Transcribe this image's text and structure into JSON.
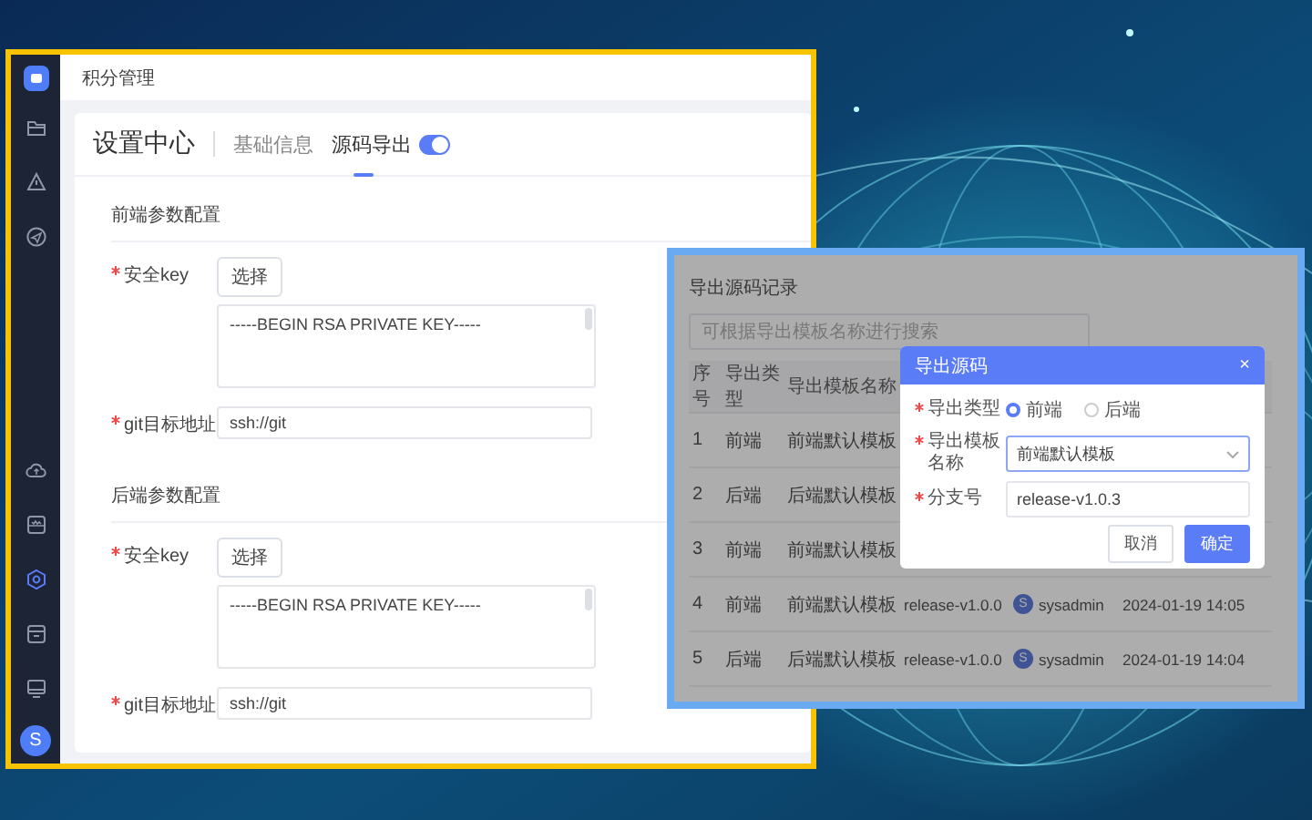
{
  "app_window": {
    "breadcrumb": "积分管理",
    "sidebar": {
      "top_items": [
        {
          "selected": false
        },
        {
          "selected": false
        },
        {
          "selected": false
        }
      ],
      "bottom_items": [
        {
          "selected": false
        },
        {
          "selected": false
        },
        {
          "selected": true
        },
        {
          "selected": false
        },
        {
          "selected": false
        }
      ],
      "avatar": "S"
    },
    "title": "设置中心",
    "tabs": [
      {
        "label": "基础信息",
        "selected": false
      },
      {
        "label": "源码导出",
        "selected": true,
        "toggle": {
          "on": true
        }
      }
    ],
    "sections": [
      {
        "title": "前端参数配置",
        "fields": [
          {
            "kind": "key",
            "label": "安全key",
            "required": true,
            "button": "选择",
            "value": "-----BEGIN RSA PRIVATE KEY-----"
          },
          {
            "kind": "input",
            "label": "git目标地址",
            "required": true,
            "value": "ssh://git"
          }
        ]
      },
      {
        "title": "后端参数配置",
        "fields": [
          {
            "kind": "key",
            "label": "安全key",
            "required": true,
            "button": "选择",
            "value": "-----BEGIN RSA PRIVATE KEY-----"
          },
          {
            "kind": "input",
            "label": "git目标地址",
            "required": true,
            "value": "ssh://git"
          }
        ]
      }
    ]
  },
  "records_window": {
    "title": "导出源码记录",
    "search": {
      "placeholder": "可根据导出模板名称进行搜索"
    },
    "table": {
      "columns": [
        "序号",
        "导出类型",
        "导出模板名称"
      ],
      "rows": [
        {
          "no": "1",
          "type": "前端",
          "template": "前端默认模板"
        },
        {
          "no": "2",
          "type": "后端",
          "template": "后端默认模板"
        },
        {
          "no": "3",
          "type": "前端",
          "template": "前端默认模板"
        },
        {
          "no": "4",
          "type": "前端",
          "template": "前端默认模板",
          "branch": "release-v1.0.0",
          "avatar": "S",
          "operator": "sysadmin",
          "time": "2024-01-19 14:05"
        },
        {
          "no": "5",
          "type": "后端",
          "template": "后端默认模板",
          "branch": "release-v1.0.0",
          "avatar": "S",
          "operator": "sysadmin",
          "time": "2024-01-19 14:04"
        }
      ]
    },
    "dialog": {
      "title": "导出源码",
      "close": "×",
      "fields": [
        {
          "kind": "radio",
          "label": "导出类型",
          "required": true,
          "options": [
            {
              "label": "前端",
              "selected": true
            },
            {
              "label": "后端",
              "selected": false
            }
          ]
        },
        {
          "kind": "select",
          "label": "导出模板名称",
          "required": true,
          "value": "前端默认模板"
        },
        {
          "kind": "input",
          "label": "分支号",
          "required": true,
          "value": "release-v1.0.3"
        }
      ],
      "buttons": [
        {
          "label": "取消",
          "kind": "default"
        },
        {
          "label": "确定",
          "kind": "primary"
        }
      ]
    }
  }
}
